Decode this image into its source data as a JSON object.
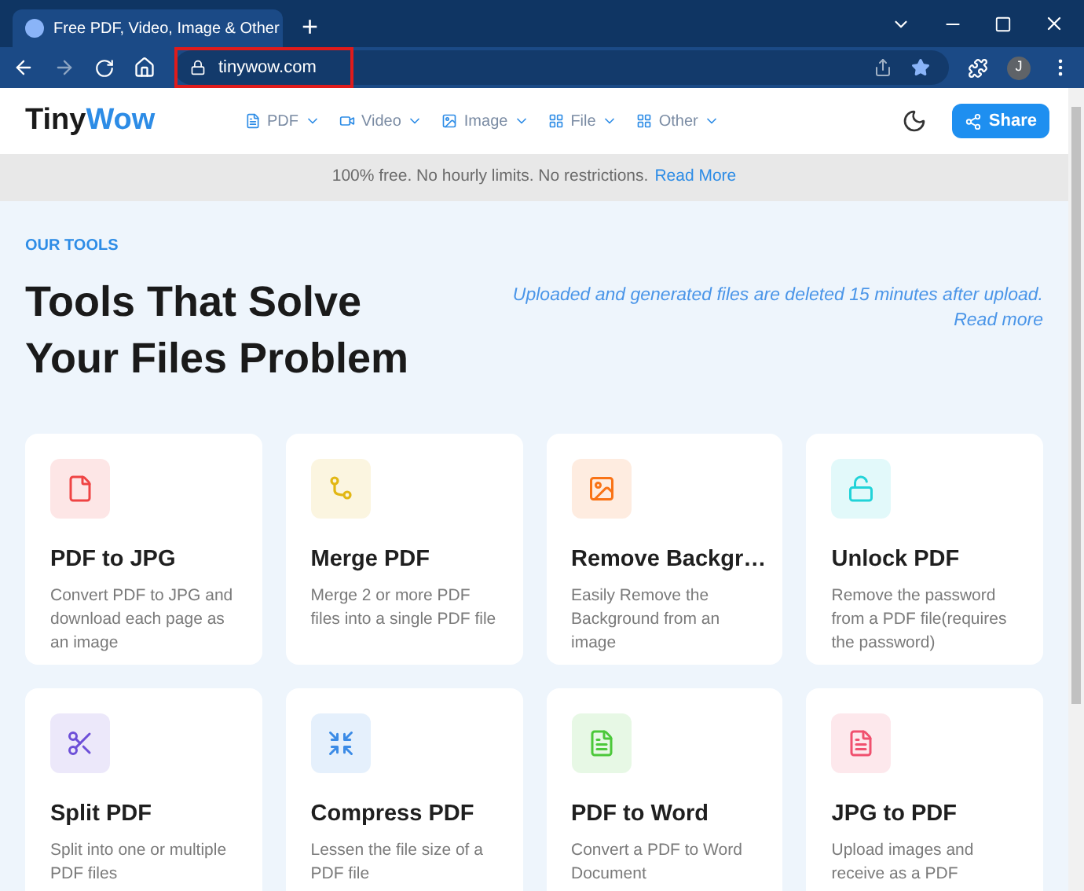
{
  "browser": {
    "tab_title": "Free PDF, Video, Image & Other",
    "new_tab": "+",
    "url": "tinywow.com",
    "profile": "J"
  },
  "header": {
    "logo_dark": "Tiny",
    "logo_accent": "Wow",
    "nav": [
      {
        "label": "PDF",
        "kind": "pdf"
      },
      {
        "label": "Video",
        "kind": "video"
      },
      {
        "label": "Image",
        "kind": "image"
      },
      {
        "label": "File",
        "kind": "grid"
      },
      {
        "label": "Other",
        "kind": "grid"
      }
    ],
    "share": "Share"
  },
  "banner": {
    "text": "100% free. No hourly limits. No restrictions.",
    "link": "Read More"
  },
  "section": {
    "eyebrow": "OUR TOOLS",
    "title_lines": [
      "Tools That Solve",
      "Your Files Problem"
    ],
    "note": "Uploaded and generated files are deleted 15 minutes after upload.",
    "note_link": "Read more"
  },
  "tools": [
    {
      "title": "PDF to JPG",
      "description": "Convert PDF to JPG and download each page as an image",
      "kind": "file",
      "color": "#ef4444"
    },
    {
      "title": "Merge PDF",
      "description": "Merge 2 or more PDF files into a single PDF file",
      "kind": "merge",
      "color": "#e2b714"
    },
    {
      "title": "Remove Backgr…",
      "description": "Easily Remove the Background from an image",
      "kind": "image",
      "color": "#f97316"
    },
    {
      "title": "Unlock PDF",
      "description": "Remove the password from a PDF file(requires the password)",
      "kind": "unlock",
      "color": "#22d3d8"
    },
    {
      "title": "Split PDF",
      "description": "Split into one or multiple PDF files",
      "kind": "scissors",
      "color": "#6d4fd8"
    },
    {
      "title": "Compress PDF",
      "description": "Lessen the file size of a PDF file",
      "kind": "compress",
      "color": "#3b8be6"
    },
    {
      "title": "PDF to Word",
      "description": "Convert a PDF to Word Document",
      "kind": "doc",
      "color": "#4cc83a"
    },
    {
      "title": "JPG to PDF",
      "description": "Upload images and receive as a PDF",
      "kind": "doc",
      "color": "#f0506e"
    }
  ]
}
